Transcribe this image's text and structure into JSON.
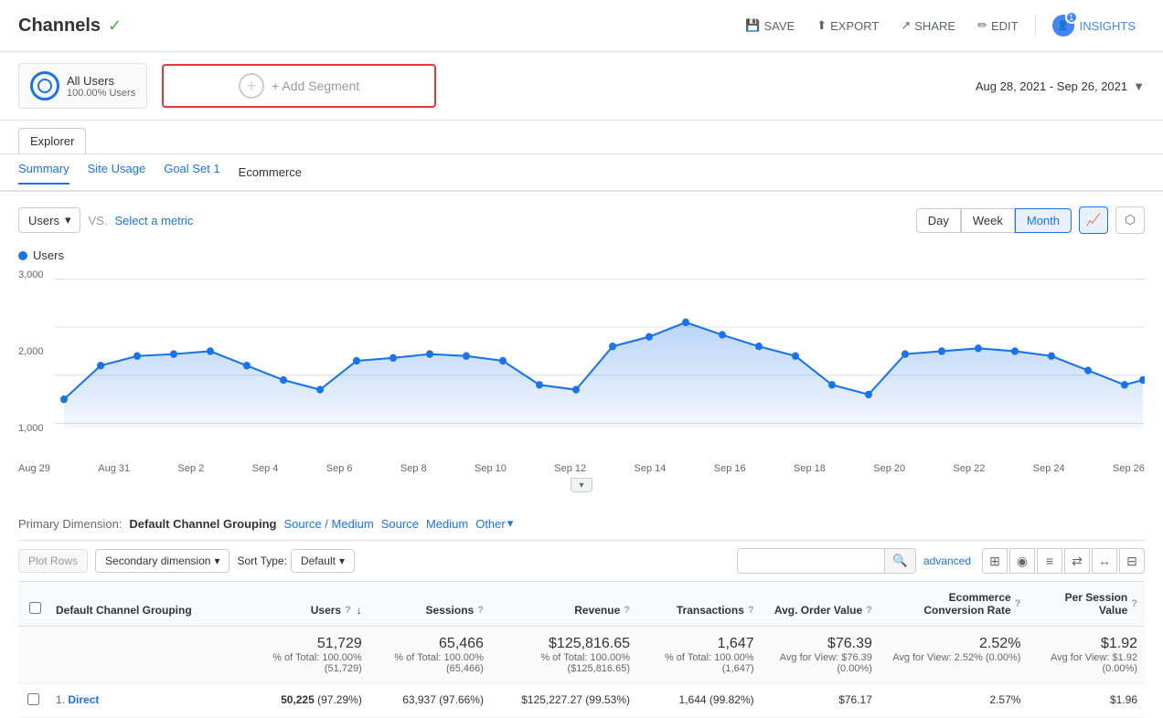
{
  "header": {
    "title": "Channels",
    "verified": true,
    "buttons": {
      "save": "SAVE",
      "export": "EXPORT",
      "share": "SHARE",
      "edit": "EDIT",
      "insights": "INSIGHTS",
      "insights_badge": "1"
    }
  },
  "segments": {
    "all_users_label": "All Users",
    "all_users_sub": "100.00% Users",
    "add_segment": "+ Add Segment"
  },
  "date_range": "Aug 28, 2021 - Sep 26, 2021",
  "explorer": {
    "tab_label": "Explorer",
    "sub_tabs": [
      {
        "label": "Summary",
        "active": true
      },
      {
        "label": "Site Usage",
        "active": false
      },
      {
        "label": "Goal Set 1",
        "active": false
      },
      {
        "label": "Ecommerce",
        "active": false
      }
    ]
  },
  "chart_controls": {
    "metric_label": "Users",
    "vs_label": "VS.",
    "select_metric": "Select a metric",
    "period_buttons": [
      "Day",
      "Week",
      "Month"
    ],
    "active_period": "Month"
  },
  "chart": {
    "legend_label": "Users",
    "y_labels": [
      "3,000",
      "2,000",
      "1,000"
    ],
    "x_labels": [
      "Aug 29",
      "Aug 31",
      "Sep 2",
      "Sep 4",
      "Sep 6",
      "Sep 8",
      "Sep 10",
      "Sep 12",
      "Sep 14",
      "Sep 16",
      "Sep 18",
      "Sep 20",
      "Sep 22",
      "Sep 24",
      "Sep 26"
    ]
  },
  "table": {
    "primary_dimension_label": "Primary Dimension:",
    "primary_dimension_active": "Default Channel Grouping",
    "dimension_links": [
      "Source / Medium",
      "Source",
      "Medium"
    ],
    "other_label": "Other",
    "plot_rows_btn": "Plot Rows",
    "secondary_dimension": "Secondary dimension",
    "sort_type_label": "Sort Type:",
    "sort_default": "Default",
    "search_placeholder": "",
    "advanced_link": "advanced",
    "columns": [
      {
        "key": "dimension",
        "label": "Default Channel Grouping"
      },
      {
        "key": "users",
        "label": "Users",
        "has_help": true,
        "has_sort": true
      },
      {
        "key": "sessions",
        "label": "Sessions",
        "has_help": true
      },
      {
        "key": "revenue",
        "label": "Revenue",
        "has_help": true
      },
      {
        "key": "transactions",
        "label": "Transactions",
        "has_help": true
      },
      {
        "key": "avg_order",
        "label": "Avg. Order Value",
        "has_help": true
      },
      {
        "key": "conv_rate",
        "label": "Ecommerce Conversion Rate",
        "has_help": true
      },
      {
        "key": "per_session",
        "label": "Per Session Value",
        "has_help": true
      }
    ],
    "total_row": {
      "users": "51,729",
      "users_sub": "% of Total: 100.00% (51,729)",
      "sessions": "65,466",
      "sessions_sub": "% of Total: 100.00% (65,466)",
      "revenue": "$125,816.65",
      "revenue_sub": "% of Total: 100.00% ($125,816.65)",
      "transactions": "1,647",
      "transactions_sub": "% of Total: 100.00% (1,647)",
      "avg_order": "$76.39",
      "avg_order_sub": "Avg for View: $76.39 (0.00%)",
      "conv_rate": "2.52%",
      "conv_rate_sub": "Avg for View: 2.52% (0.00%)",
      "per_session": "$1.92",
      "per_session_sub": "Avg for View: $1.92 (0.00%)"
    },
    "rows": [
      {
        "num": "1.",
        "dimension": "Direct",
        "users": "50,225",
        "users_pct": "(97.29%)",
        "sessions": "63,937",
        "sessions_pct": "(97.66%)",
        "revenue": "$125,227.27",
        "revenue_pct": "(99.53%)",
        "transactions": "1,644",
        "transactions_pct": "(99.82%)",
        "avg_order": "$76.17",
        "conv_rate": "2.57%",
        "per_session": "$1.96"
      }
    ]
  }
}
